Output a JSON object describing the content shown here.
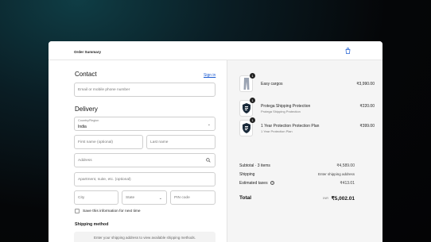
{
  "header": {
    "title": "Order Summary",
    "bag_icon": "shopping-bag-icon"
  },
  "contact": {
    "heading": "Contact",
    "sign_in": "Sign in",
    "email_placeholder": "Email or mobile phone number"
  },
  "delivery": {
    "heading": "Delivery",
    "country_label": "Country/Region",
    "country_value": "India",
    "first_name": "First name (optional)",
    "last_name": "Last name",
    "address": "Address",
    "apartment": "Apartment, suite, etc. (optional)",
    "city": "City",
    "state": "State",
    "pin": "PIN code",
    "save_info": "Save this information for next time"
  },
  "shipping": {
    "heading": "Shipping method",
    "notice": "Enter your shipping address to view available shipping methods."
  },
  "summary": {
    "items": [
      {
        "name": "Easy cargos",
        "subtitle": "",
        "price": "₹3,990.00",
        "qty": "1",
        "thumb_icon": "cargo-pants-thumbnail"
      },
      {
        "name": "Protega Shipping Protection",
        "subtitle": "Protega Shipping Protection",
        "price": "₹220.00",
        "qty": "1",
        "thumb_icon": "shield-icon"
      },
      {
        "name": "1 Year Protection Protection Plan",
        "subtitle": "1 Year Protection Plan",
        "price": "₹399.00",
        "qty": "1",
        "thumb_icon": "shield-icon"
      }
    ],
    "subtotal_label": "Subtotal · 3 items",
    "subtotal_value": "₹4,589.00",
    "shipping_label": "Shipping",
    "shipping_value": "Enter shipping address",
    "taxes_label": "Estimated taxes",
    "taxes_value": "₹413.01",
    "total_label": "Total",
    "total_currency": "INR",
    "total_value": "₹5,002.01"
  }
}
